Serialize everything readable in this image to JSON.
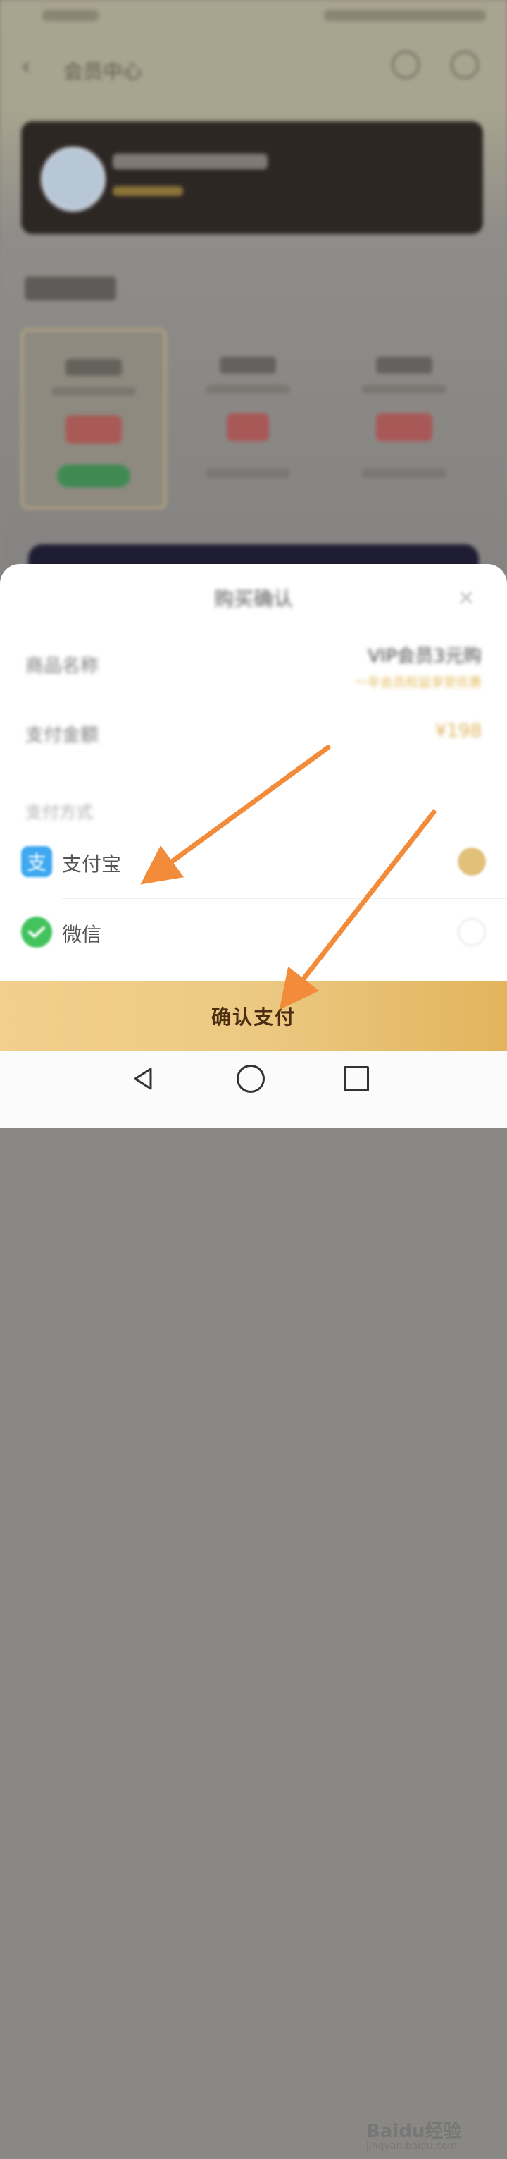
{
  "background_page": {
    "nav_back_icon": "chevron-left-icon",
    "nav_title": "会员中心"
  },
  "sheet": {
    "title": "购买确认",
    "close_icon": "close-icon",
    "product_label": "商品名称",
    "product_value": "VIP会员3元购",
    "product_note": "一年会员权益享受优惠",
    "amount_label": "支付金额",
    "amount_value": "¥198",
    "method_heading": "支付方式",
    "methods": [
      {
        "icon": "alipay-icon",
        "label": "支付宝",
        "selected": true
      },
      {
        "icon": "wechat-icon",
        "label": "微信",
        "selected": false
      }
    ],
    "confirm_label": "确认支付"
  },
  "watermark": {
    "main": "Baidu经验",
    "url": "jingyan.baidu.com"
  },
  "colors": {
    "accent": "#e1c07a",
    "confirm_text": "#4b2d12",
    "arrow": "#f28c3a"
  }
}
